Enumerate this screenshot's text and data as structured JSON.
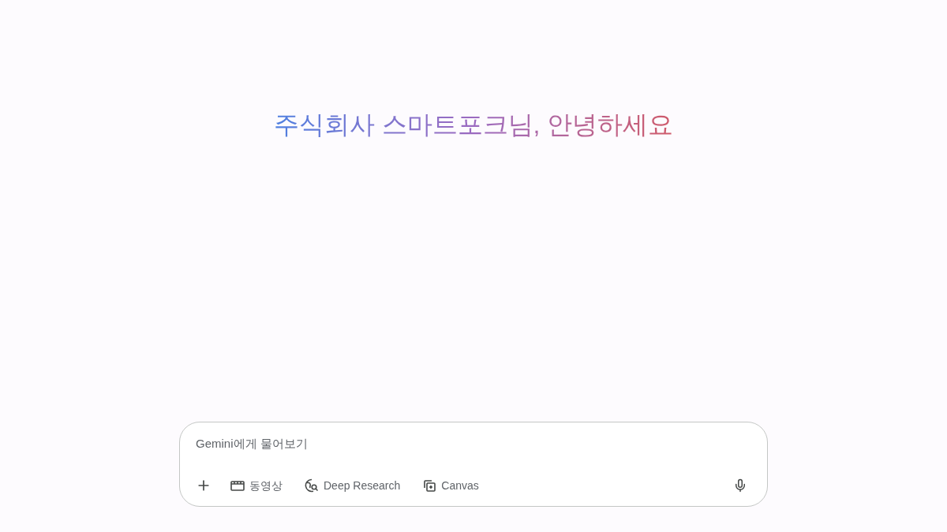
{
  "greeting": "주식회사 스마트포크님, 안녕하세요",
  "prompt": {
    "placeholder": "Gemini에게 물어보기"
  },
  "tools": [
    {
      "kind": "video",
      "label": "동영상"
    },
    {
      "kind": "research",
      "label": "Deep Research"
    },
    {
      "kind": "canvas",
      "label": "Canvas"
    }
  ]
}
